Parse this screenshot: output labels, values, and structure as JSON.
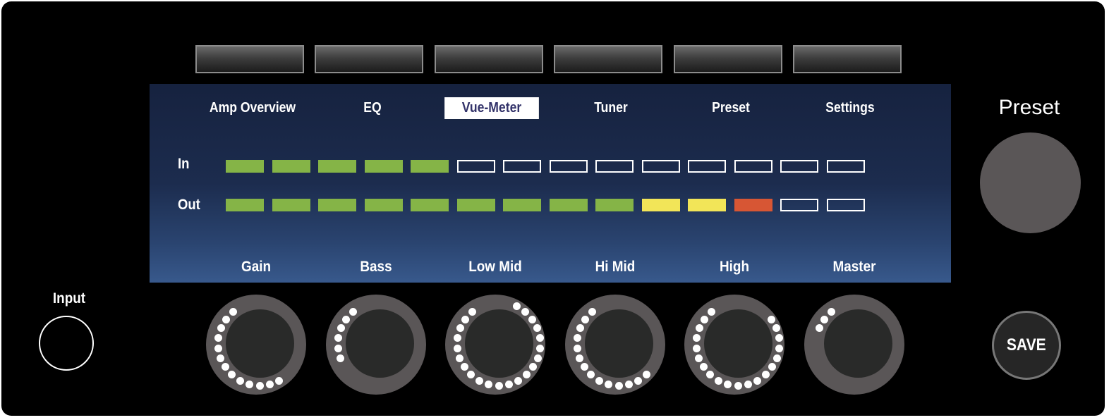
{
  "softkeys": [
    "",
    "",
    "",
    "",
    "",
    ""
  ],
  "tabs": [
    "Amp Overview",
    "EQ",
    "Vue-Meter",
    "Tuner",
    "Preset",
    "Settings"
  ],
  "active_tab": "Vue-Meter",
  "meters": {
    "in": {
      "label": "In",
      "segments": [
        "on",
        "on",
        "on",
        "on",
        "on",
        "off",
        "off",
        "off",
        "off",
        "off",
        "off",
        "off",
        "off",
        "off"
      ]
    },
    "out": {
      "label": "Out",
      "segments": [
        "on",
        "on",
        "on",
        "on",
        "on",
        "on",
        "on",
        "on",
        "on",
        "yellow",
        "yellow",
        "red",
        "off",
        "off"
      ]
    }
  },
  "colors": {
    "on": "#85b447",
    "yellow": "#f2e558",
    "red": "#d75634",
    "off": "transparent"
  },
  "knobs": [
    {
      "label": "Gain",
      "level": 0.55
    },
    {
      "label": "Bass",
      "level": 0.25
    },
    {
      "label": "Low Mid",
      "level": 0.9
    },
    {
      "label": "Hi Mid",
      "level": 0.6
    },
    {
      "label": "High",
      "level": 0.85
    },
    {
      "label": "Master",
      "level": 0.12
    }
  ],
  "input_label": "Input",
  "preset_label": "Preset",
  "save_label": "SAVE"
}
